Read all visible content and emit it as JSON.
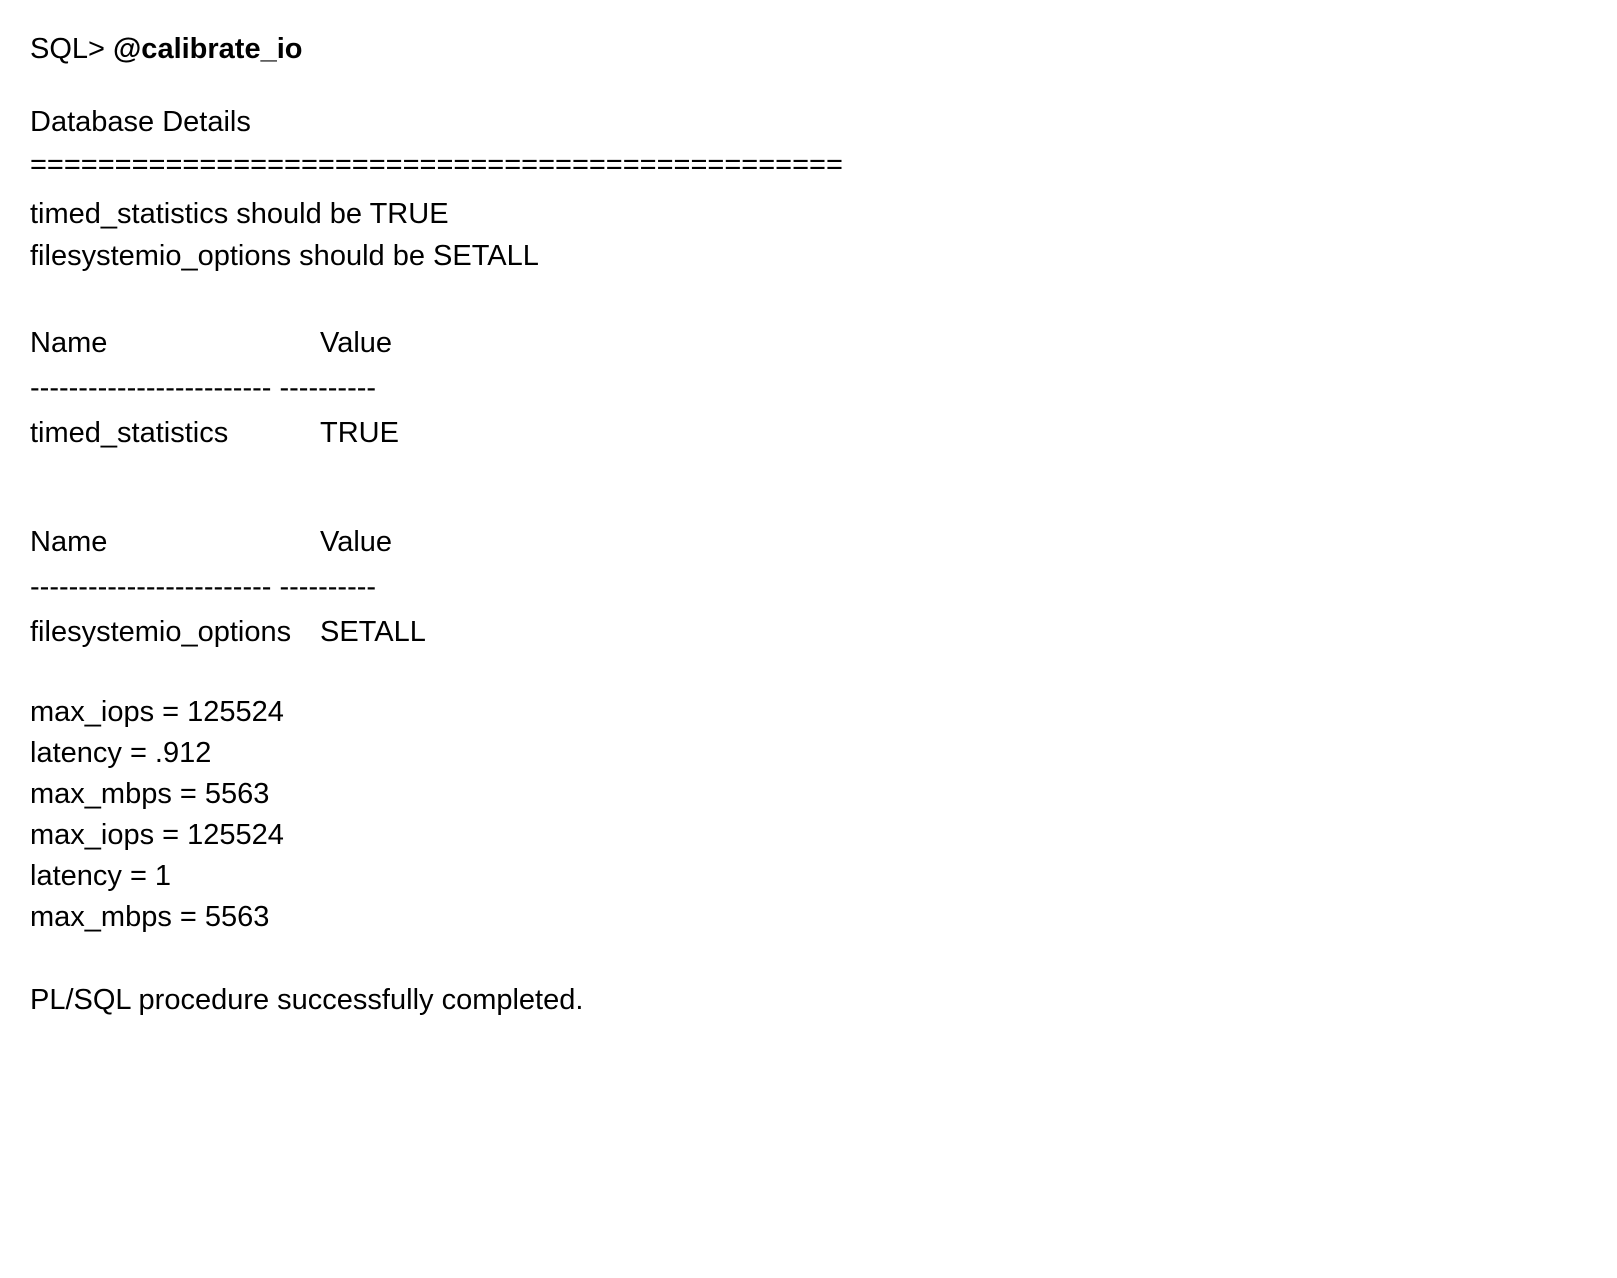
{
  "prompt": "SQL> ",
  "command": "@calibrate_io",
  "section_title": "Database Details",
  "divider": "================================================",
  "requirements": {
    "line1": "timed_statistics should be TRUE",
    "line2": "filesystemio_options should be SETALL"
  },
  "table1": {
    "header_name": "Name",
    "header_value": "Value",
    "dashes": "------------------------- ----------",
    "row": {
      "name": "timed_statistics",
      "value": "TRUE"
    }
  },
  "table2": {
    "header_name": "Name",
    "header_value": "Value",
    "dashes": "------------------------- ----------",
    "row": {
      "name": "filesystemio_options",
      "value": "SETALL"
    }
  },
  "metrics": {
    "l1": "max_iops = 125524",
    "l2": "latency  = .912",
    "l3": "max_mbps = 5563",
    "l4": "max_iops = 125524",
    "l5": "latency = 1",
    "l6": "max_mbps = 5563"
  },
  "footer": "PL/SQL procedure successfully completed."
}
